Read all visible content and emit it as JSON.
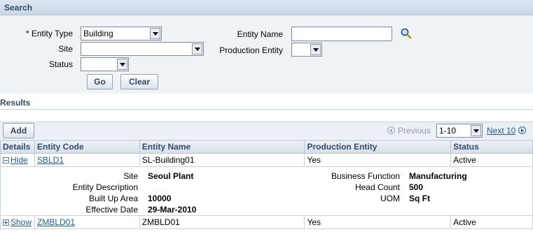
{
  "search": {
    "title": "Search",
    "required_marker": "*",
    "entity_type_label": "Entity Type",
    "entity_type_value": "Building",
    "site_label": "Site",
    "site_value": "",
    "status_label": "Status",
    "status_value": "",
    "entity_name_label": "Entity Name",
    "entity_name_value": "",
    "production_entity_label": "Production Entity",
    "production_entity_value": "",
    "go_label": "Go",
    "clear_label": "Clear"
  },
  "results": {
    "title": "Results",
    "add_label": "Add",
    "previous_label": "Previous",
    "range_value": "1-10",
    "next_label": "Next 10",
    "columns": [
      "Details",
      "Entity Code",
      "Entity Name",
      "Production Entity",
      "Status"
    ],
    "rows": [
      {
        "toggle": "Hide",
        "entity_code": "SBLD1",
        "entity_name": "SL-Building01",
        "production_entity": "Yes",
        "status": "Active"
      },
      {
        "toggle": "Show",
        "entity_code": "ZMBLD01",
        "entity_name": "ZMBLD01",
        "production_entity": "Yes",
        "status": "Active"
      }
    ],
    "detail": {
      "site_label": "Site",
      "site_value": "Seoul Plant",
      "entity_description_label": "Entity Description",
      "entity_description_value": "",
      "built_up_area_label": "Built Up Area",
      "built_up_area_value": "10000",
      "effective_date_label": "Effective Date",
      "effective_date_value": "29-Mar-2010",
      "business_function_label": "Business Function",
      "business_function_value": "Manufacturing",
      "head_count_label": "Head Count",
      "head_count_value": "500",
      "uom_label": "UOM",
      "uom_value": "Sq Ft"
    }
  },
  "icons": {
    "search": "magnifier-icon",
    "expand": "plus-box-icon",
    "collapse": "minus-box-icon",
    "prev": "circle-left-arrow-icon",
    "next": "circle-right-arrow-icon"
  }
}
